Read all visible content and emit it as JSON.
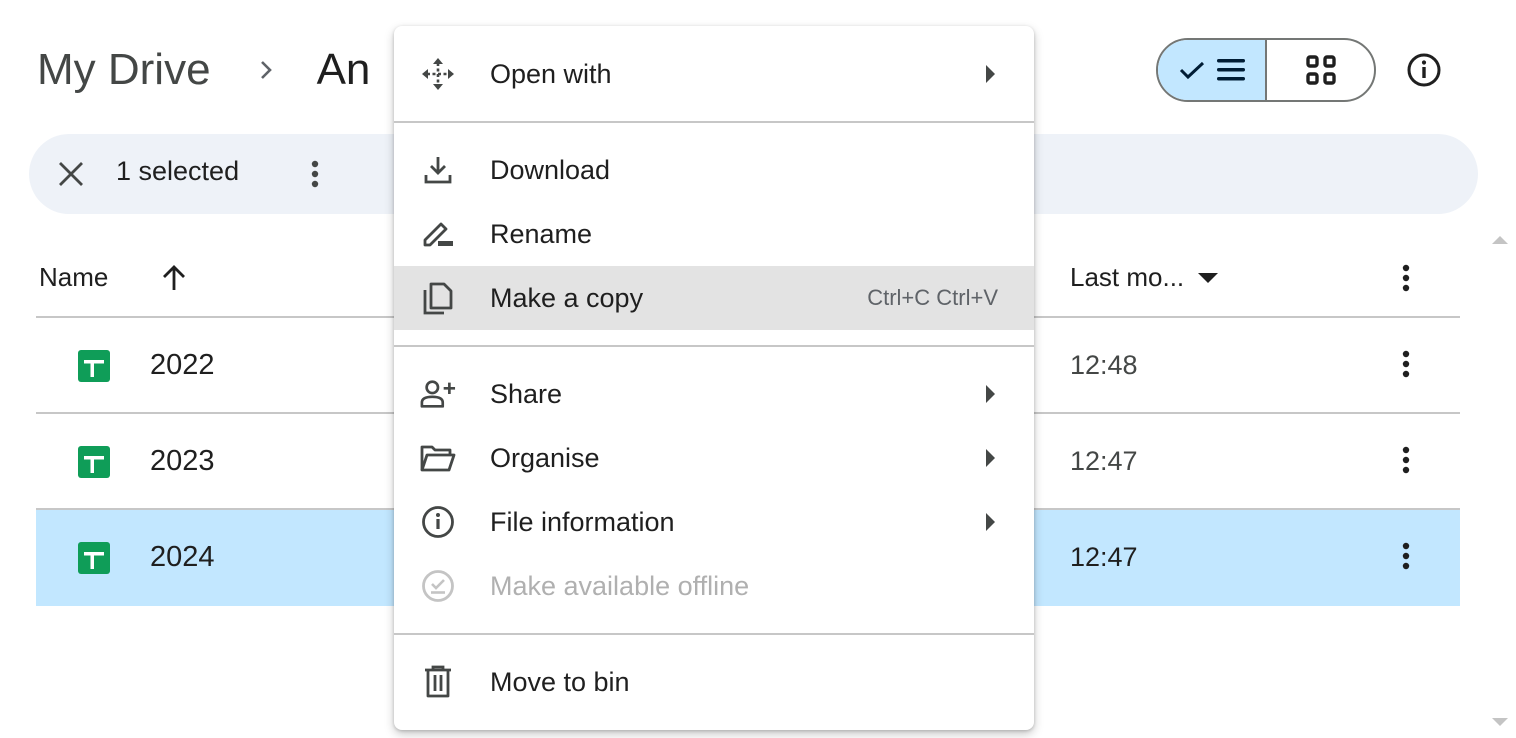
{
  "header": {
    "breadcrumb_root": "My Drive",
    "breadcrumb_current": "An",
    "breadcrumb_separator_icon": "chevron-right-icon",
    "view_toggle": {
      "list_icon": "checkmark-list-icon",
      "grid_icon": "grid-icon",
      "active": "list"
    },
    "info_icon": "info-icon"
  },
  "selection_bar": {
    "count_label": "1 selected",
    "close_icon": "close-icon",
    "more_icon": "more-vertical-icon"
  },
  "table": {
    "columns": {
      "name": "Name",
      "name_sort": "ascending",
      "last_modified": "Last mo..."
    },
    "rows": [
      {
        "name": "2022",
        "type": "spreadsheet",
        "last_modified": "12:48",
        "selected": false
      },
      {
        "name": "2023",
        "type": "spreadsheet",
        "last_modified": "12:47",
        "selected": false
      },
      {
        "name": "2024",
        "type": "spreadsheet",
        "last_modified": "12:47",
        "selected": true
      }
    ]
  },
  "context_menu": {
    "items": [
      {
        "label": "Open with",
        "icon": "open-with-icon",
        "submenu": true
      },
      {
        "label": "Download",
        "icon": "download-icon"
      },
      {
        "label": "Rename",
        "icon": "rename-icon"
      },
      {
        "label": "Make a copy",
        "icon": "copy-icon",
        "shortcut": "Ctrl+C Ctrl+V",
        "hovered": true
      },
      {
        "label": "Share",
        "icon": "share-icon",
        "submenu": true
      },
      {
        "label": "Organise",
        "icon": "folder-icon",
        "submenu": true
      },
      {
        "label": "File information",
        "icon": "info-icon",
        "submenu": true
      },
      {
        "label": "Make available offline",
        "icon": "offline-icon",
        "disabled": true
      },
      {
        "label": "Move to bin",
        "icon": "trash-icon"
      }
    ]
  },
  "colors": {
    "selected_row": "#c2e7ff",
    "selection_bar": "#eef2f8",
    "sheets_green": "#0f9d58",
    "menu_hover": "#e3e3e3"
  }
}
